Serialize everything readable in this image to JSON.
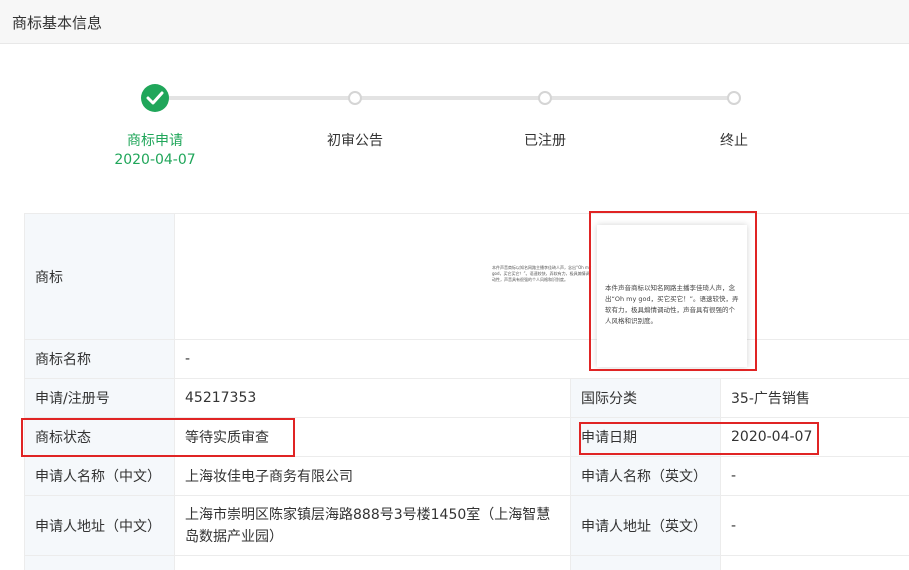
{
  "header": {
    "title": "商标基本信息"
  },
  "steps": [
    {
      "label": "商标申请",
      "date": "2020-04-07",
      "done": true
    },
    {
      "label": "初审公告"
    },
    {
      "label": "已注册"
    },
    {
      "label": "终止"
    }
  ],
  "colors": {
    "accent": "#20a65a",
    "link": "#1e7ed8",
    "highlight": "#e02424"
  },
  "info": {
    "trademark_label": "商标",
    "trademark_text": "本件声音商标以知名网路主播李佳琦人声，念出“Oh my god，买它买它！”。语速较快，弄软有力，极具煽情调动性，声音具有很强的个人风格和识别度。",
    "name_label": "商标名称",
    "name_value": "-",
    "reg_no_label": "申请/注册号",
    "reg_no_value": "45217353",
    "intl_class_label": "国际分类",
    "intl_class_value": "35-广告销售",
    "status_label": "商标状态",
    "status_value": "等待实质审查",
    "apply_date_label": "申请日期",
    "apply_date_value": "2020-04-07",
    "applicant_cn_label": "申请人名称（中文）",
    "applicant_cn_value": "上海妆佳电子商务有限公司",
    "applicant_en_label": "申请人名称（英文）",
    "applicant_en_value": "-",
    "address_cn_label": "申请人地址（中文）",
    "address_cn_value": "上海市崇明区陈家镇层海路888号3号楼1450室（上海智慧岛数据产业园）",
    "address_en_label": "申请人地址（英文）",
    "address_en_value": "-"
  }
}
